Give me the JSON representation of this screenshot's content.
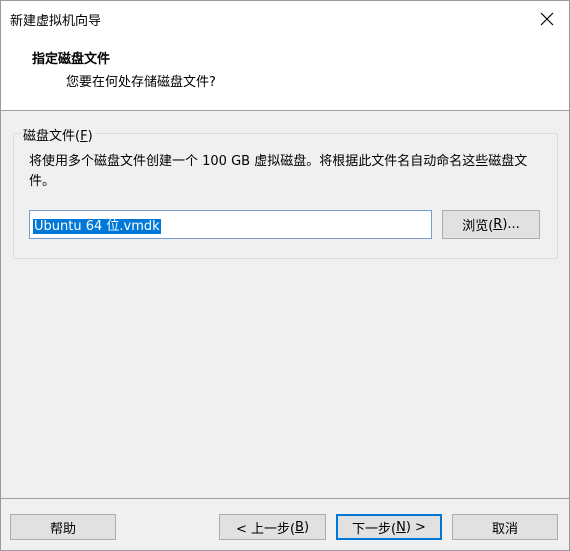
{
  "window": {
    "title": "新建虚拟机向导"
  },
  "header": {
    "title": "指定磁盘文件",
    "subtitle": "您要在何处存储磁盘文件?"
  },
  "disk_file": {
    "group_label": "磁盘文件(F)",
    "group_label_text": "磁盘文件(",
    "group_label_key": "F",
    "group_label_end": ")",
    "description": "将使用多个磁盘文件创建一个 100 GB 虚拟磁盘。将根据此文件名自动命名这些磁盘文件。",
    "path_value": "Ubuntu 64 位.vmdk",
    "browse_label": "浏览(R)...",
    "browse_text": "浏览(",
    "browse_key": "R",
    "browse_end": ")..."
  },
  "footer": {
    "help_label": "帮助",
    "back_label": "< 上一步(B)",
    "back_text": "< 上一步(",
    "back_key": "B",
    "back_end": ")",
    "next_label": "下一步(N) >",
    "next_text": "下一步(",
    "next_key": "N",
    "next_end": ") >",
    "cancel_label": "取消"
  },
  "icons": {
    "close": "close-icon"
  }
}
